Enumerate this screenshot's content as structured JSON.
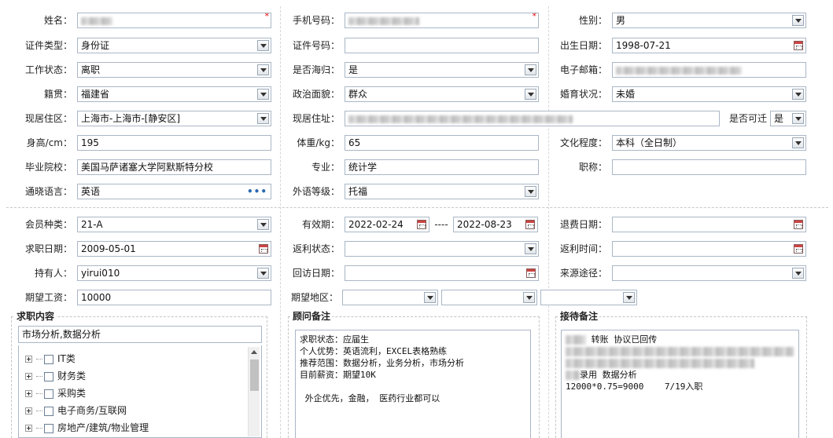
{
  "personal": {
    "name_label": "姓名：",
    "phone_label": "手机号码：",
    "gender_label": "性别：",
    "gender_value": "男",
    "idtype_label": "证件类型：",
    "idtype_value": "身份证",
    "idno_label": "证件号码：",
    "idno_value": "",
    "birth_label": "出生日期：",
    "birth_value": "1998-07-21",
    "workstatus_label": "工作状态：",
    "workstatus_value": "离职",
    "returnee_label": "是否海归：",
    "returnee_value": "是",
    "email_label": "电子邮箱：",
    "native_label": "籍贯：",
    "native_value": "福建省",
    "political_label": "政治面貌：",
    "political_value": "群众",
    "marital_label": "婚育状况：",
    "marital_value": "未婚",
    "residence_label": "现居住区：",
    "residence_value": "上海市-上海市-[静安区]",
    "address_label": "现居住址：",
    "relocate_label": "是否可迁",
    "relocate_value": "是",
    "height_label": "身高/cm：",
    "height_value": "195",
    "weight_label": "体重/kg：",
    "weight_value": "65",
    "education_label": "文化程度：",
    "education_value": "本科（全日制）",
    "school_label": "毕业院校：",
    "school_value": "美国马萨诸塞大学阿默斯特分校",
    "major_label": "专业：",
    "major_value": "统计学",
    "title_label": "职称：",
    "title_value": "",
    "language_label": "通晓语言：",
    "language_value": "英语",
    "language_more": "•••",
    "langlevel_label": "外语等级：",
    "langlevel_value": "托福",
    "required_mark": "*"
  },
  "membership": {
    "type_label": "会员种类：",
    "type_value": "21-A",
    "valid_label": "有效期：",
    "valid_from": "2022-02-24",
    "valid_sep": "----",
    "valid_to": "2022-08-23",
    "refund_date_label": "退费日期：",
    "refund_date_value": "",
    "job_date_label": "求职日期：",
    "job_date_value": "2009-05-01",
    "rebate_status_label": "返利状态：",
    "rebate_status_value": "",
    "rebate_time_label": "返利时间：",
    "rebate_time_value": "",
    "holder_label": "持有人：",
    "holder_value": "yirui010",
    "visit_date_label": "回访日期：",
    "visit_date_value": "",
    "source_label": "来源途径：",
    "source_value": "",
    "salary_label": "期望工资：",
    "salary_value": "10000",
    "region_label": "期望地区：",
    "region_1": "",
    "region_2": "",
    "region_3": ""
  },
  "job_content": {
    "legend": "求职内容",
    "selected": "市场分析,数据分析",
    "categories": [
      "IT类",
      "财务类",
      "采购类",
      "电子商务/互联网",
      "房地产/建筑/物业管理"
    ]
  },
  "consultant_notes": {
    "legend": "顾问备注",
    "lines": [
      "求职状态：应届生",
      "个人优势：英语流利，EXCEL表格熟练",
      "推荐范围：数据分析，业务分析，市场分析",
      "目前薪资：期望10K",
      "",
      " 外企优先，金融， 医药行业都可以"
    ]
  },
  "reception_notes": {
    "legend": "接待备注",
    "line1": "转账 协议已回传",
    "line4": "录用 数据分析",
    "line5": "12000*0.75=9000    7/19入职"
  }
}
